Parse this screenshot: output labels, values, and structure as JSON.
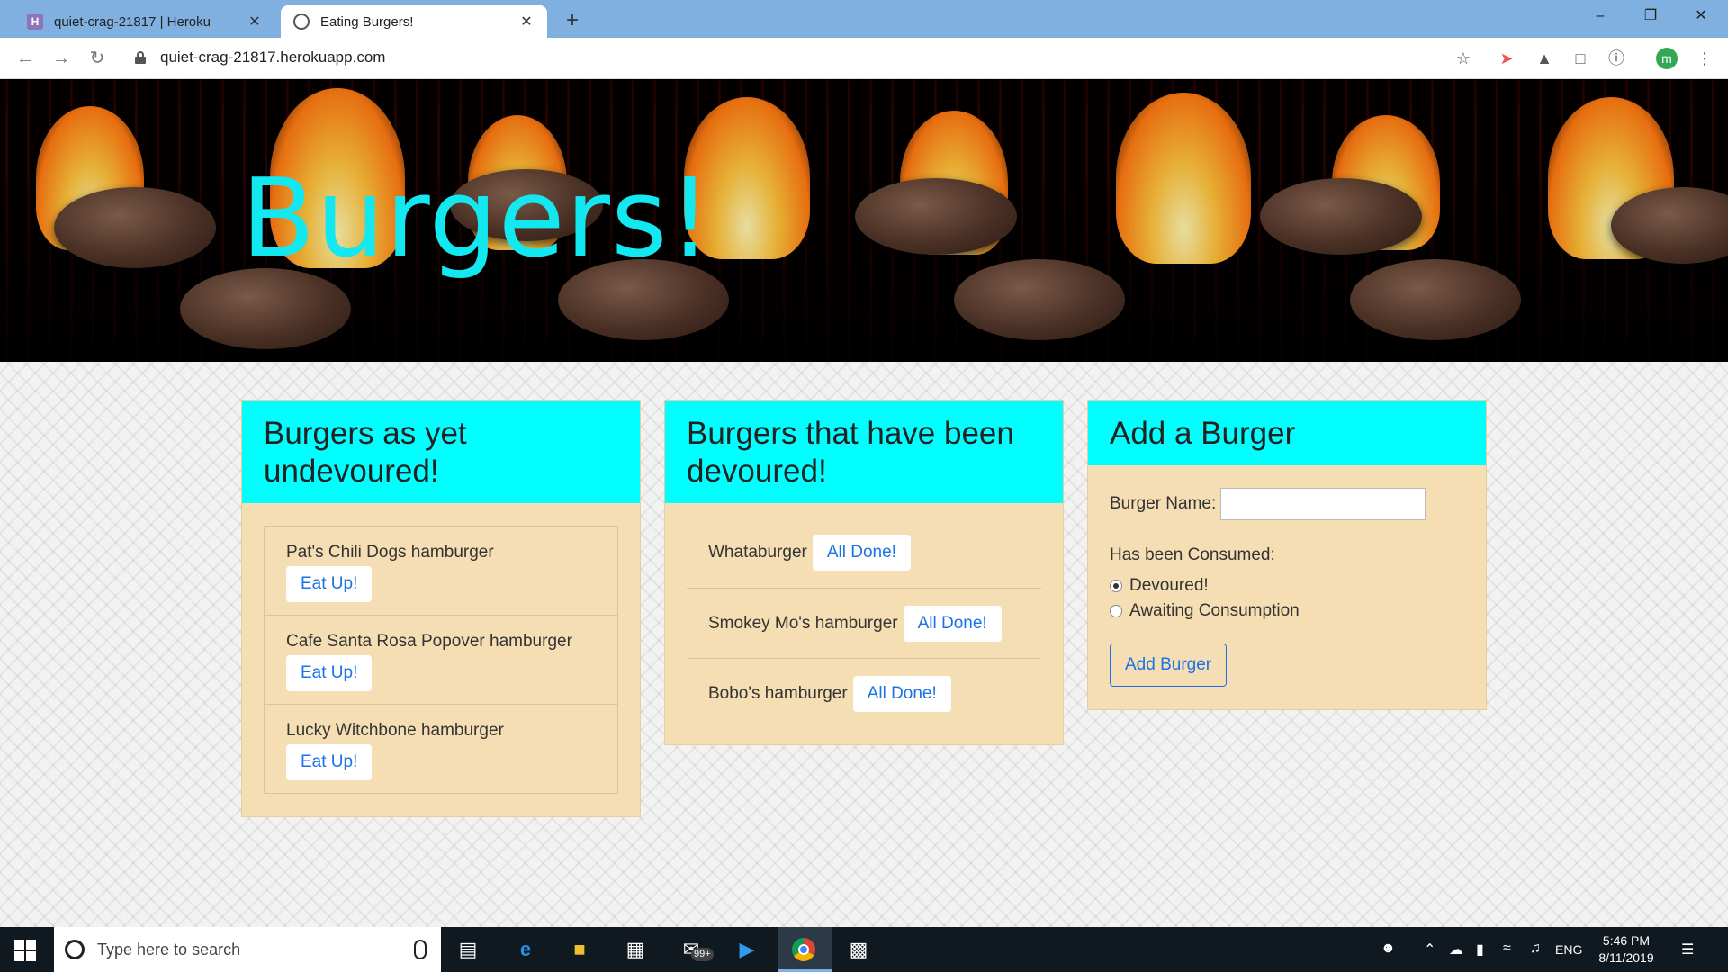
{
  "browser": {
    "tabs": [
      {
        "title": "quiet-crag-21817 | Heroku",
        "icon": "heroku-icon",
        "active": false
      },
      {
        "title": "Eating Burgers!",
        "icon": "globe-icon",
        "active": true
      }
    ],
    "url": "quiet-crag-21817.herokuapp.com",
    "profile_initial": "m"
  },
  "hero": {
    "title": "Burgers!"
  },
  "undevoured": {
    "header": "Burgers as yet undevoured!",
    "items": [
      {
        "name": "Pat's Chili Dogs hamburger",
        "button": "Eat Up!"
      },
      {
        "name": "Cafe Santa Rosa Popover hamburger",
        "button": "Eat Up!"
      },
      {
        "name": "Lucky Witchbone hamburger",
        "button": "Eat Up!"
      }
    ]
  },
  "devoured": {
    "header": "Burgers that have been devoured!",
    "items": [
      {
        "name": "Whataburger",
        "button": "All Done!"
      },
      {
        "name": "Smokey Mo's hamburger",
        "button": "All Done!"
      },
      {
        "name": "Bobo's hamburger",
        "button": "All Done!"
      }
    ]
  },
  "add_form": {
    "header": "Add a Burger",
    "name_label": "Burger Name:",
    "name_value": "",
    "consumed_label": "Has been Consumed:",
    "options": [
      {
        "label": "Devoured!",
        "checked": true
      },
      {
        "label": "Awaiting Consumption",
        "checked": false
      }
    ],
    "submit_label": "Add Burger"
  },
  "taskbar": {
    "search_placeholder": "Type here to search",
    "mail_badge": "99+",
    "language": "ENG",
    "time": "5:46 PM",
    "date": "8/11/2019"
  },
  "colors": {
    "header_bg": "#00ffff",
    "card_bg": "#f5deb3",
    "title_color": "#13e8f0",
    "link_blue": "#1a73e8"
  }
}
